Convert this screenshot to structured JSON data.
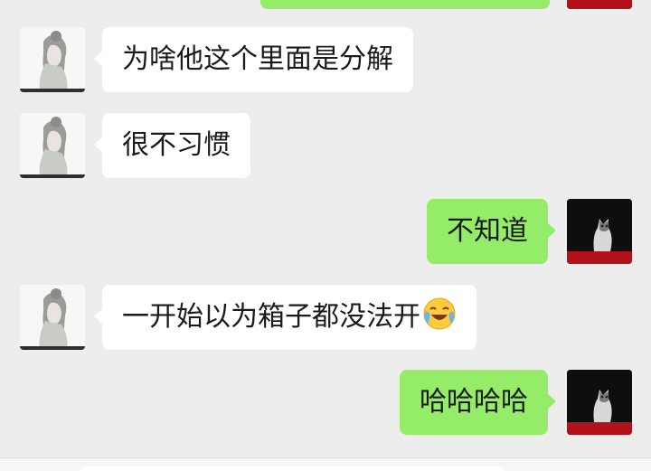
{
  "chat": {
    "messages": [
      {
        "side": "left",
        "text": "为啥他这个里面是分解",
        "avatar": "girl-avatar"
      },
      {
        "side": "left",
        "text": "很不习惯",
        "avatar": "girl-avatar"
      },
      {
        "side": "right",
        "text": "不知道",
        "avatar": "cat-avatar"
      },
      {
        "side": "left",
        "text": "一开始以为箱子都没法开",
        "emoji": "loudly-laughing-emoji",
        "avatar": "girl-avatar"
      },
      {
        "side": "right",
        "text": "哈哈哈哈",
        "avatar": "cat-avatar"
      }
    ]
  },
  "colors": {
    "background": "#ededed",
    "incoming_bubble": "#ffffff",
    "outgoing_bubble": "#95ec69"
  }
}
